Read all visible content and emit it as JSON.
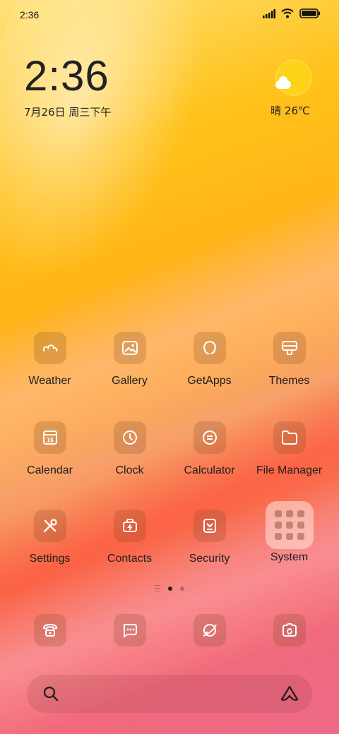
{
  "status_bar": {
    "time": "2:36"
  },
  "clock_widget": {
    "time": "2:36",
    "date": "7月26日 周三下午"
  },
  "weather_widget": {
    "text": "晴 26℃",
    "icon": "sun-cloud-icon"
  },
  "apps": [
    {
      "label": "Weather",
      "icon": "weather-icon"
    },
    {
      "label": "Gallery",
      "icon": "gallery-icon"
    },
    {
      "label": "GetApps",
      "icon": "getapps-icon"
    },
    {
      "label": "Themes",
      "icon": "themes-icon"
    },
    {
      "label": "Calendar",
      "icon": "calendar-icon",
      "badge": "16"
    },
    {
      "label": "Clock",
      "icon": "clock-icon"
    },
    {
      "label": "Calculator",
      "icon": "calculator-icon"
    },
    {
      "label": "File Manager",
      "icon": "folder-icon"
    },
    {
      "label": "Settings",
      "icon": "settings-icon"
    },
    {
      "label": "Contacts",
      "icon": "contacts-icon"
    },
    {
      "label": "Security",
      "icon": "security-icon"
    },
    {
      "label": "System",
      "icon": "system-folder-icon"
    }
  ],
  "pager": {
    "pages": 2,
    "active": 1
  },
  "dock": [
    {
      "icon": "phone-icon"
    },
    {
      "icon": "messages-icon"
    },
    {
      "icon": "browser-icon"
    },
    {
      "icon": "camera-icon"
    }
  ]
}
